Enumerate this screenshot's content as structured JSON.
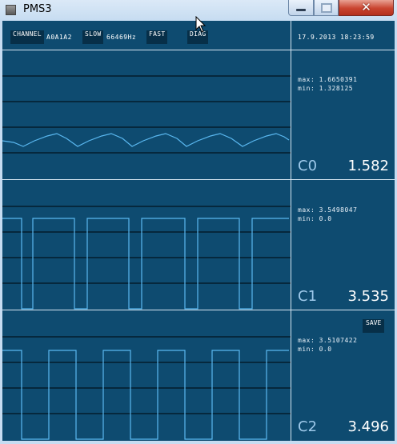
{
  "window": {
    "title": "PMS3",
    "close_glyph": "✕"
  },
  "toolbar": {
    "channel_label": "CHANNEL",
    "channel_value": "A0A1A2",
    "slow_label": "SLOW",
    "frequency": "66469Hz",
    "fast_label": "FAST",
    "diag_label": "DIAG",
    "timestamp": "17.9.2013 18:23:59"
  },
  "channels": [
    {
      "label": "C0",
      "value": "1.582",
      "max": "max: 1.6650391",
      "min": "min: 1.328125"
    },
    {
      "label": "C1",
      "value": "3.535",
      "max": "max: 3.5498047",
      "min": "min: 0.0"
    },
    {
      "label": "C2",
      "value": "3.496",
      "max": "max: 3.5107422",
      "min": "min: 0.0",
      "save_label": "SAVE"
    }
  ],
  "colors": {
    "background": "#0e4b70",
    "trace": "#5ab8f0",
    "gridline": "#02141f",
    "button": "#072f48"
  }
}
